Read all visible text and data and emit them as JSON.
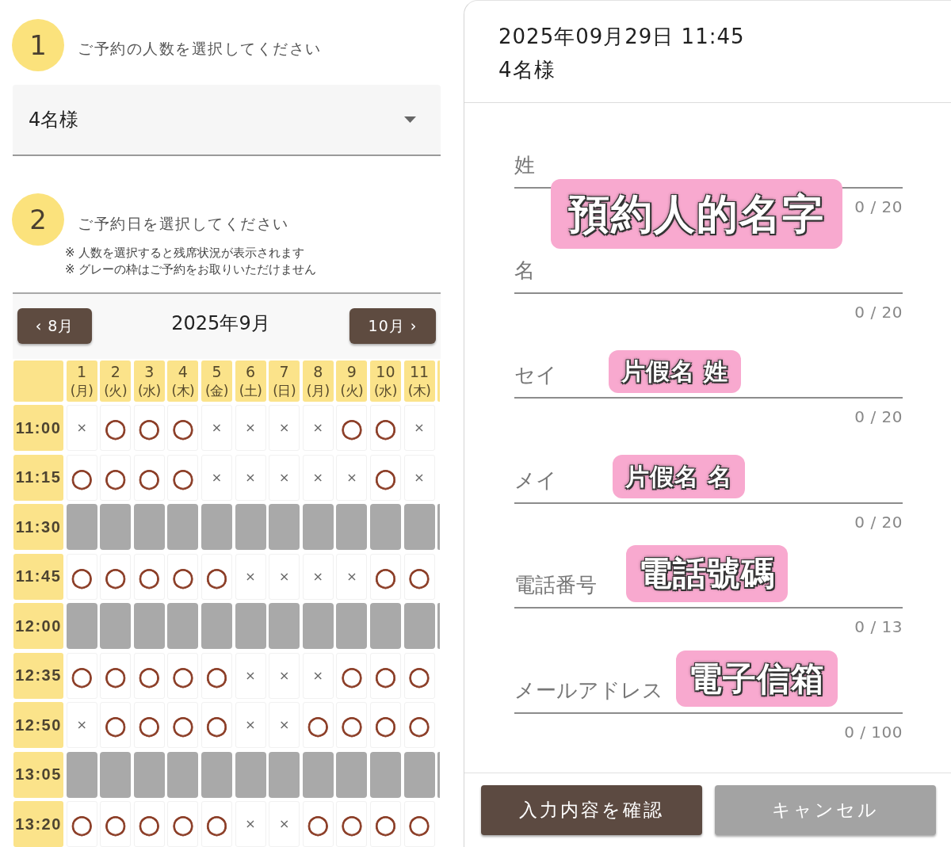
{
  "steps": [
    {
      "number": "1",
      "label": "ご予約の人数を選択してください"
    },
    {
      "number": "2",
      "label": "ご予約日を選択してください"
    }
  ],
  "party_select": {
    "value": "4名様"
  },
  "notes": [
    "※ 人数を選択すると残席状況が表示されます",
    "※ グレーの枠はご予約をお取りいただけません"
  ],
  "calendar": {
    "prev_button": "‹ 8月",
    "title": "2025年9月",
    "next_button": "10月 ›",
    "days": [
      {
        "day": "1",
        "weekday": "(月)"
      },
      {
        "day": "2",
        "weekday": "(火)"
      },
      {
        "day": "3",
        "weekday": "(水)"
      },
      {
        "day": "4",
        "weekday": "(木)"
      },
      {
        "day": "5",
        "weekday": "(金)"
      },
      {
        "day": "6",
        "weekday": "(土)"
      },
      {
        "day": "7",
        "weekday": "(日)"
      },
      {
        "day": "8",
        "weekday": "(月)"
      },
      {
        "day": "9",
        "weekday": "(火)"
      },
      {
        "day": "10",
        "weekday": "(水)"
      },
      {
        "day": "11",
        "weekday": "(木)"
      }
    ],
    "rows": [
      {
        "time": "11:00",
        "kind": "open",
        "slots": [
          {
            "mark": "×",
            "available": false
          },
          {
            "mark": "○",
            "available": true
          },
          {
            "mark": "○",
            "available": true
          },
          {
            "mark": "○",
            "available": true
          },
          {
            "mark": "×",
            "available": false
          },
          {
            "mark": "×",
            "available": false
          },
          {
            "mark": "×",
            "available": false
          },
          {
            "mark": "×",
            "available": false
          },
          {
            "mark": "○",
            "available": true
          },
          {
            "mark": "○",
            "available": true
          },
          {
            "mark": "×",
            "available": false
          }
        ]
      },
      {
        "time": "11:15",
        "kind": "open",
        "slots": [
          {
            "mark": "○",
            "available": true
          },
          {
            "mark": "○",
            "available": true
          },
          {
            "mark": "○",
            "available": true
          },
          {
            "mark": "○",
            "available": true
          },
          {
            "mark": "×",
            "available": false
          },
          {
            "mark": "×",
            "available": false
          },
          {
            "mark": "×",
            "available": false
          },
          {
            "mark": "×",
            "available": false
          },
          {
            "mark": "×",
            "available": false
          },
          {
            "mark": "○",
            "available": true
          },
          {
            "mark": "×",
            "available": false
          }
        ]
      },
      {
        "time": "11:30",
        "kind": "closed"
      },
      {
        "time": "11:45",
        "kind": "open",
        "slots": [
          {
            "mark": "○",
            "available": true
          },
          {
            "mark": "○",
            "available": true
          },
          {
            "mark": "○",
            "available": true
          },
          {
            "mark": "○",
            "available": true
          },
          {
            "mark": "○",
            "available": true
          },
          {
            "mark": "×",
            "available": false
          },
          {
            "mark": "×",
            "available": false
          },
          {
            "mark": "×",
            "available": false
          },
          {
            "mark": "×",
            "available": false
          },
          {
            "mark": "○",
            "available": true
          },
          {
            "mark": "○",
            "available": true
          }
        ]
      },
      {
        "time": "12:00",
        "kind": "closed"
      },
      {
        "time": "12:35",
        "kind": "open",
        "slots": [
          {
            "mark": "○",
            "available": true
          },
          {
            "mark": "○",
            "available": true
          },
          {
            "mark": "○",
            "available": true
          },
          {
            "mark": "○",
            "available": true
          },
          {
            "mark": "○",
            "available": true
          },
          {
            "mark": "×",
            "available": false
          },
          {
            "mark": "×",
            "available": false
          },
          {
            "mark": "×",
            "available": false
          },
          {
            "mark": "○",
            "available": true
          },
          {
            "mark": "○",
            "available": true
          },
          {
            "mark": "○",
            "available": true
          }
        ]
      },
      {
        "time": "12:50",
        "kind": "open",
        "slots": [
          {
            "mark": "×",
            "available": false
          },
          {
            "mark": "○",
            "available": true
          },
          {
            "mark": "○",
            "available": true
          },
          {
            "mark": "○",
            "available": true
          },
          {
            "mark": "○",
            "available": true
          },
          {
            "mark": "×",
            "available": false
          },
          {
            "mark": "×",
            "available": false
          },
          {
            "mark": "○",
            "available": true
          },
          {
            "mark": "○",
            "available": true
          },
          {
            "mark": "○",
            "available": true
          },
          {
            "mark": "○",
            "available": true
          }
        ]
      },
      {
        "time": "13:05",
        "kind": "closed"
      },
      {
        "time": "13:20",
        "kind": "open",
        "slots": [
          {
            "mark": "○",
            "available": true
          },
          {
            "mark": "○",
            "available": true
          },
          {
            "mark": "○",
            "available": true
          },
          {
            "mark": "○",
            "available": true
          },
          {
            "mark": "○",
            "available": true
          },
          {
            "mark": "×",
            "available": false
          },
          {
            "mark": "×",
            "available": false
          },
          {
            "mark": "○",
            "available": true
          },
          {
            "mark": "○",
            "available": true
          },
          {
            "mark": "○",
            "available": true
          },
          {
            "mark": "○",
            "available": true
          }
        ]
      }
    ]
  },
  "reservation": {
    "datetime": "2025年09月29日 11:45",
    "party": "4名様"
  },
  "fields": [
    {
      "placeholder": "姓",
      "counter": "0 / 20",
      "annotation": "預約人的名字"
    },
    {
      "placeholder": "名",
      "counter": "0 / 20"
    },
    {
      "placeholder": "セイ",
      "counter": "0 / 20",
      "annotation": "片假名 姓"
    },
    {
      "placeholder": "メイ",
      "counter": "0 / 20",
      "annotation": "片假名 名"
    },
    {
      "placeholder": "電話番号",
      "counter": "0 / 13",
      "annotation": "電話號碼"
    },
    {
      "placeholder": "メールアドレス",
      "counter": "0 / 100",
      "annotation": "電子信箱"
    }
  ],
  "buttons": [
    {
      "label": "入力内容を確認",
      "kind": "primary"
    },
    {
      "label": "キャンセル",
      "kind": "secondary"
    }
  ]
}
